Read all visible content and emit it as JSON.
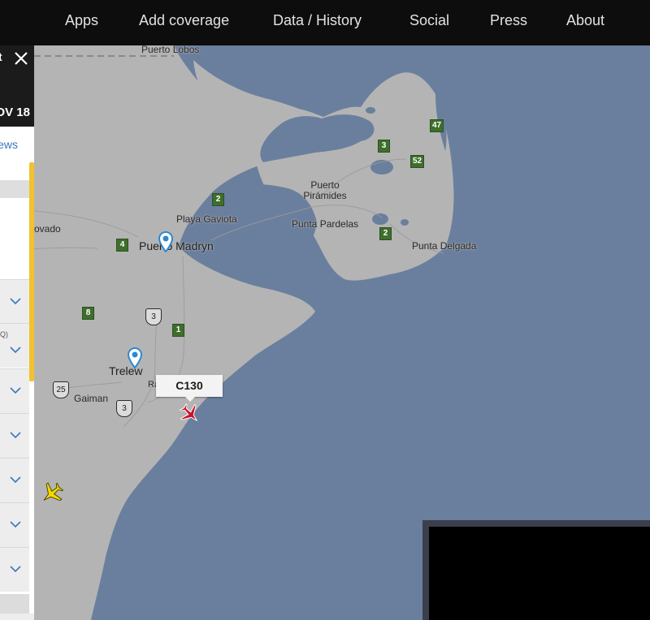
{
  "nav": {
    "items": [
      "Apps",
      "Add coverage",
      "Data / History",
      "Social",
      "Press",
      "About"
    ]
  },
  "panel": {
    "header_clip": "t",
    "date_clip": "OV 18",
    "news_clip": "ews",
    "row_snippet": "Q)"
  },
  "map": {
    "places": {
      "puerto_lobos": "Puerto Lobos",
      "puerto_piramides": "Puerto\nPirámides",
      "playa_gaviota": "Playa Gaviota",
      "punta_pardelas": "Punta Pardelas",
      "punta_delgada": "Punta Delgada",
      "puerto_madryn": "Puerto Madryn",
      "corcovado_clip": "ovado",
      "trelew": "Trelew",
      "rawson_clip": "Raws",
      "gaiman": "Gaiman"
    },
    "routes_green": [
      "47",
      "3",
      "52",
      "2",
      "2",
      "4",
      "8",
      "1"
    ],
    "routes_shield": [
      "3",
      "25",
      "3"
    ],
    "callsign": "C130"
  },
  "colors": {
    "water": "#6a7f9e",
    "land": "#b4b4b4",
    "plane_selected": "#c8102e",
    "plane_other": "#f5d800",
    "pin": "#2d87d0",
    "nav_bg": "#0d0d0d",
    "scroll_accent": "#f2c12e"
  },
  "icons": {
    "close": "close-icon",
    "chevron": "chevron-down-icon",
    "pin": "location-pin-icon",
    "plane": "airplane-icon"
  }
}
